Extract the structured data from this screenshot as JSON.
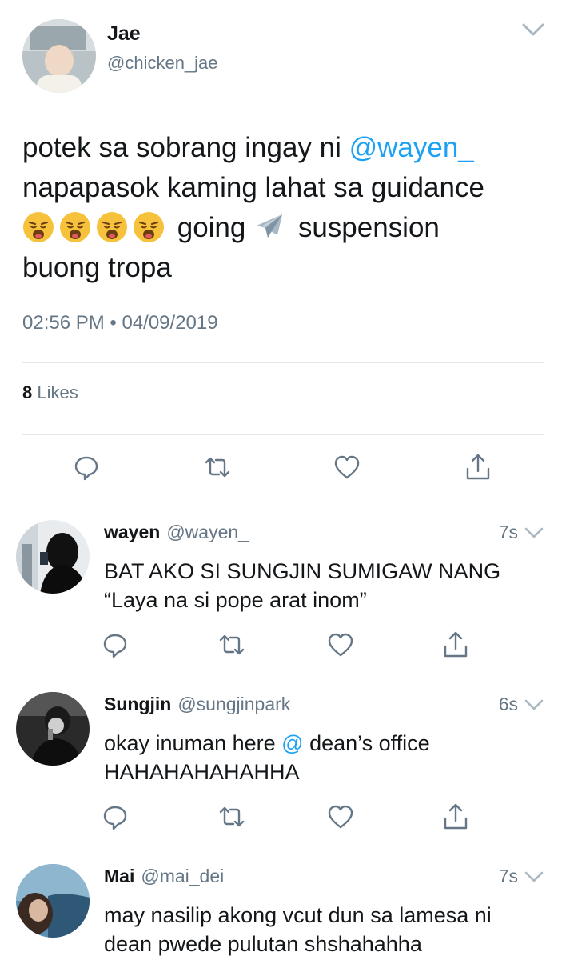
{
  "main_tweet": {
    "author_name": "Jae",
    "author_handle": "@chicken_jae",
    "text_part1": "potek sa sobrang ingay ni ",
    "mention": "@wayen_",
    "text_part2": "napapasok kaming lahat sa guidance",
    "text_part3": " going ",
    "text_part4": " suspension",
    "text_part5": "buong tropa",
    "timestamp": "02:56 PM • 04/09/2019",
    "likes_count": "8",
    "likes_label": "Likes"
  },
  "replies": [
    {
      "name": "wayen",
      "handle": "@wayen_",
      "time": "7s",
      "line1": "BAT AKO SI SUNGJIN SUMIGAW NANG",
      "line2": "“Laya na si pope arat inom”"
    },
    {
      "name": "Sungjin",
      "handle": "@sungjinpark",
      "time": "6s",
      "line1_a": "okay inuman here ",
      "line1_mention": "@",
      "line1_b": " dean’s office",
      "line2": "HAHAHAHAHAHHA"
    },
    {
      "name": "Mai",
      "handle": "@mai_dei",
      "time": "7s",
      "line1": "may nasilip akong vcut dun sa lamesa ni",
      "line2": "dean pwede pulutan shshahahha"
    }
  ],
  "icons": {
    "reply": "speech-bubble-icon",
    "retweet": "retweet-icon",
    "like": "heart-icon",
    "share": "share-icon",
    "more": "chevron-down-icon"
  },
  "colors": {
    "mention": "#1da1f2",
    "secondary_text": "#657786",
    "divider": "#e1e8ed"
  }
}
